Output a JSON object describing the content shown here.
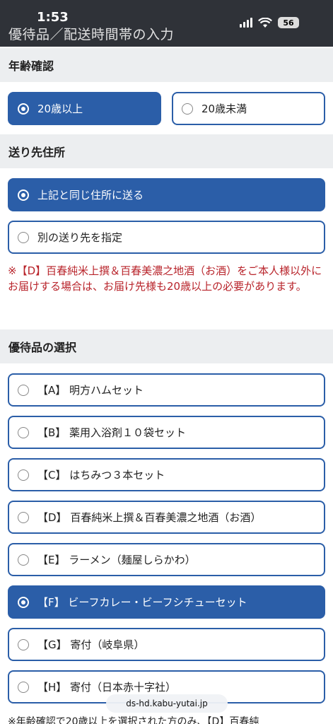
{
  "status_bar": {
    "time": "1:53",
    "battery": "56"
  },
  "header": {
    "title": "優待品／配送時間帯の入力"
  },
  "age_section": {
    "heading": "年齢確認",
    "options": [
      {
        "label": "20歳以上",
        "selected": true
      },
      {
        "label": "20歳未満",
        "selected": false
      }
    ]
  },
  "address_section": {
    "heading": "送り先住所",
    "options": [
      {
        "label": "上記と同じ住所に送る",
        "selected": true
      },
      {
        "label": "別の送り先を指定",
        "selected": false
      }
    ],
    "notice": "※【D】百春純米上撰＆百春美濃之地酒（お酒）をご本人様以外にお届けする場合は、お届け先様も20歳以上の必要があります。"
  },
  "gift_section": {
    "heading": "優待品の選択",
    "options": [
      {
        "label": "【A】 明方ハムセット",
        "selected": false
      },
      {
        "label": "【B】 薬用入浴剤１０袋セット",
        "selected": false
      },
      {
        "label": "【C】 はちみつ３本セット",
        "selected": false
      },
      {
        "label": "【D】 百春純米上撰＆百春美濃之地酒（お酒）",
        "selected": false
      },
      {
        "label": "【E】 ラーメン（麺屋しらかわ）",
        "selected": false
      },
      {
        "label": "【F】 ビーフカレー・ビーフシチューセット",
        "selected": true
      },
      {
        "label": "【G】 寄付（岐阜県）",
        "selected": false
      },
      {
        "label": "【H】 寄付（日本赤十字社）",
        "selected": false
      }
    ]
  },
  "footer": {
    "note": "※年齢確認で20歳以上を選択された方のみ、【D】百春純",
    "url": "ds-hd.kabu-yutai.jp"
  }
}
